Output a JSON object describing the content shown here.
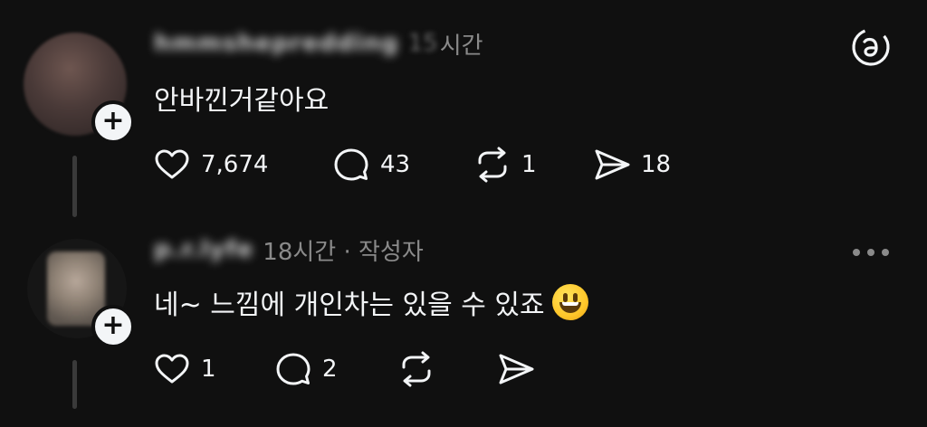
{
  "posts": [
    {
      "username": "hmmshepredding",
      "time_blurred": "15",
      "time_suffix": "시간",
      "text": "안바낀거같아요",
      "likes": "7,674",
      "replies": "43",
      "reposts": "1",
      "shares": "18"
    },
    {
      "username": "p.r.lyfe",
      "time": "18시간 · 작성자",
      "text": "네~ 느낌에 개인차는 있을 수 있죠",
      "emoji": "grinning-face",
      "likes": "1",
      "replies": "2"
    }
  ],
  "icons": {
    "top_right": "threads-logo-icon",
    "more": "more-horizontal-icon"
  },
  "colors": {
    "background": "#101010",
    "text": "#f3f5f7",
    "muted": "#8a8a8a"
  }
}
